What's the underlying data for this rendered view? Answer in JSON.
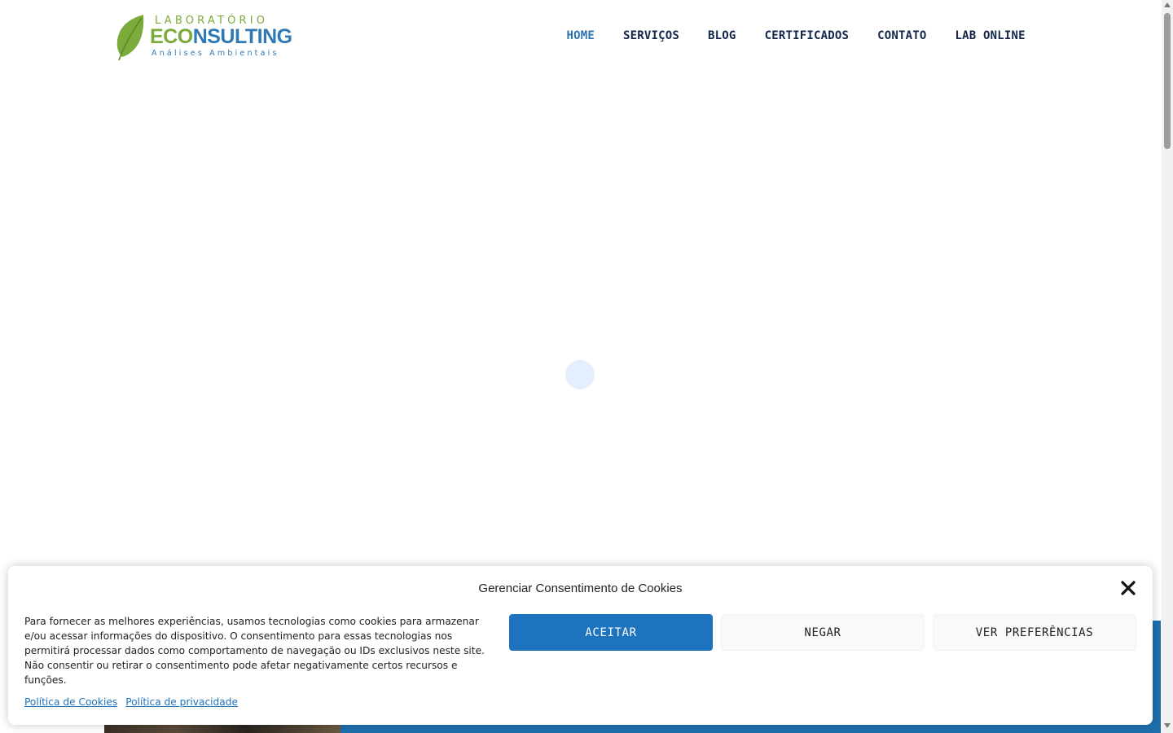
{
  "logo": {
    "line1": "LABORATÓRIO",
    "eco": "ECO",
    "sulting": "NSULTING",
    "tagline": "Análises Ambientais"
  },
  "nav": {
    "items": [
      {
        "label": "HOME",
        "active": true
      },
      {
        "label": "SERVIÇOS"
      },
      {
        "label": "BLOG"
      },
      {
        "label": "CERTIFICADOS"
      },
      {
        "label": "CONTATO"
      },
      {
        "label": "LAB ONLINE"
      }
    ]
  },
  "cookie": {
    "title": "Gerenciar Consentimento de Cookies",
    "text": "Para fornecer as melhores experiências, usamos tecnologias como cookies para armazenar e/ou acessar informações do dispositivo. O consentimento para essas tecnologias nos permitirá processar dados como comportamento de navegação ou IDs exclusivos neste site. Não consentir ou retirar o consentimento pode afetar negativamente certos recursos e funções.",
    "accept": "ACEITAR",
    "deny": "NEGAR",
    "preferences": "VER PREFERÊNCIAS",
    "cookie_policy": "Política de Cookies",
    "privacy_policy": "Política de privacidade"
  },
  "colors": {
    "brand_green": "#7bab3b",
    "brand_blue": "#2f79b6",
    "nav_text": "#13264a",
    "nav_active": "#2e73b3",
    "accept_button": "#1e73be"
  }
}
